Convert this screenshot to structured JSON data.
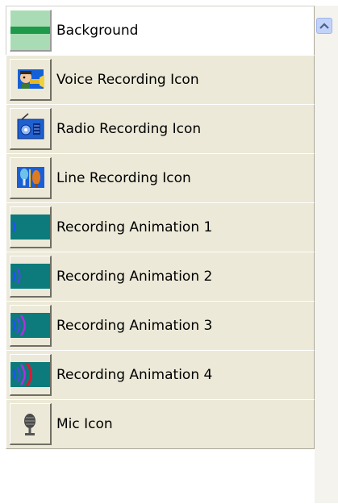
{
  "list": {
    "items": [
      {
        "label": "Background",
        "icon": "background-swatch-icon",
        "selected": true
      },
      {
        "label": "Voice Recording Icon",
        "icon": "voice-recording-icon",
        "selected": false
      },
      {
        "label": "Radio Recording Icon",
        "icon": "radio-recording-icon",
        "selected": false
      },
      {
        "label": "Line Recording Icon",
        "icon": "line-recording-icon",
        "selected": false
      },
      {
        "label": "Recording Animation 1",
        "icon": "recording-animation-1-icon",
        "selected": false
      },
      {
        "label": "Recording Animation 2",
        "icon": "recording-animation-2-icon",
        "selected": false
      },
      {
        "label": "Recording Animation 3",
        "icon": "recording-animation-3-icon",
        "selected": false
      },
      {
        "label": "Recording Animation 4",
        "icon": "recording-animation-4-icon",
        "selected": false
      },
      {
        "label": "Mic Icon",
        "icon": "mic-icon",
        "selected": false
      }
    ]
  },
  "scrollbar": {
    "up_arrow_icon": "chevron-up-icon"
  },
  "colors": {
    "item_background": "#ece9d8",
    "selected_item_background": "#ffffff",
    "selected_swatch": "#a9dcb4",
    "swatch_bar": "#1e9a4a",
    "animation_teal": "#0d7b7b"
  }
}
